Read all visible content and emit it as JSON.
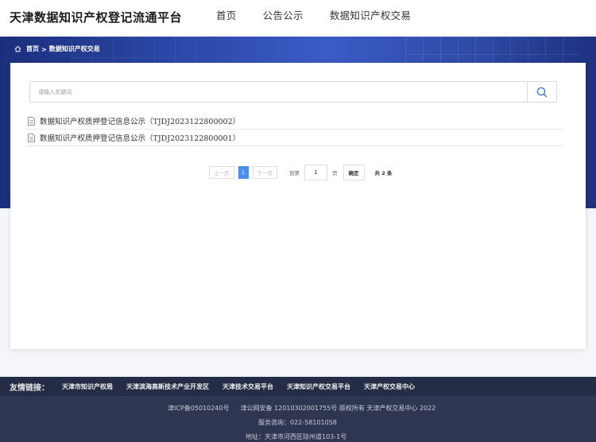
{
  "header": {
    "site_title": "天津数据知识产权登记流通平台",
    "nav": [
      "首页",
      "公告公示",
      "数据知识产权交易"
    ]
  },
  "breadcrumb": {
    "home": "首页",
    "sep": ">",
    "current": "数据知识产权交易"
  },
  "search": {
    "placeholder": "请输入关键词",
    "value": ""
  },
  "list": [
    "数据知识产权质押登记信息公示（TJDJ2023122800002）",
    "数据知识产权质押登记信息公示（TJDJ2023122800001）"
  ],
  "pagination": {
    "prev": "上一页",
    "current_page": "1",
    "next": "下一页",
    "goto_prefix": "到第",
    "goto_value": "1",
    "goto_suffix": "页",
    "confirm": "确定",
    "total": "共 2 条"
  },
  "footer": {
    "friend_label": "友情链接：",
    "friend_links": [
      "天津市知识产权局",
      "天津滨海高新技术产业开发区",
      "天津技术交易平台",
      "天津知识产权交易平台",
      "天津产权交易中心"
    ],
    "icp": "津ICP备05010240号",
    "security": "津公网安备 12010302001755号 版权所有 天津产权交易中心 2022",
    "phone": "服务咨询：022-58101058",
    "address": "地址：天津市河西区琼州道103-1号"
  },
  "colors": {
    "banner": "#2b48a8",
    "accent": "#4a8ef0",
    "footer": "#2f3651"
  }
}
